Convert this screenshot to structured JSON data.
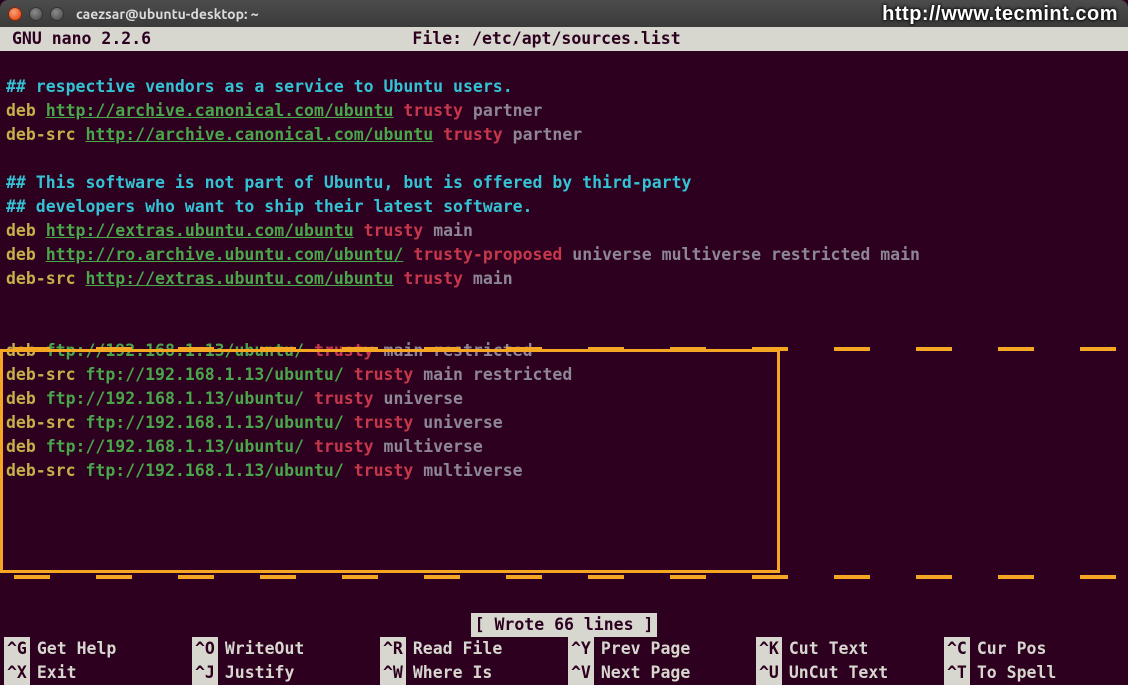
{
  "titlebar": {
    "title": "caezsar@ubuntu-desktop: ~"
  },
  "watermark": "http://www.tecmint.com",
  "nano": {
    "app": "GNU nano 2.2.6",
    "file_label": "File: /etc/apt/sources.list",
    "status": "[ Wrote 66 lines ]"
  },
  "lines": [
    {
      "t": "comment",
      "text": "## respective vendors as a service to Ubuntu users."
    },
    {
      "t": "deb",
      "kw": "deb",
      "url": "http://archive.canonical.com/ubuntu",
      "suite": "trusty",
      "comp": "partner"
    },
    {
      "t": "deb",
      "kw": "deb-src",
      "url": "http://archive.canonical.com/ubuntu",
      "suite": "trusty",
      "comp": "partner"
    },
    {
      "t": "empty"
    },
    {
      "t": "comment",
      "text": "## This software is not part of Ubuntu, but is offered by third-party"
    },
    {
      "t": "comment",
      "text": "## developers who want to ship their latest software."
    },
    {
      "t": "deb",
      "kw": "deb",
      "url": "http://extras.ubuntu.com/ubuntu",
      "suite": "trusty",
      "comp": "main"
    },
    {
      "t": "deb",
      "kw": "deb",
      "url": "http://ro.archive.ubuntu.com/ubuntu/",
      "suite": "trusty-proposed",
      "comp": "universe multiverse restricted main"
    },
    {
      "t": "deb",
      "kw": "deb-src",
      "url": "http://extras.ubuntu.com/ubuntu",
      "suite": "trusty",
      "comp": "main"
    },
    {
      "t": "empty"
    },
    {
      "t": "empty"
    },
    {
      "t": "deb",
      "kw": "deb",
      "url": "ftp://192.168.1.13/ubuntu/",
      "suite": "trusty",
      "comp": "main restricted"
    },
    {
      "t": "deb",
      "kw": "deb-src",
      "url": "ftp://192.168.1.13/ubuntu/",
      "suite": "trusty",
      "comp": "main restricted"
    },
    {
      "t": "deb",
      "kw": "deb",
      "url": "ftp://192.168.1.13/ubuntu/",
      "suite": "trusty",
      "comp": "universe"
    },
    {
      "t": "deb",
      "kw": "deb-src",
      "url": "ftp://192.168.1.13/ubuntu/",
      "suite": "trusty",
      "comp": "universe"
    },
    {
      "t": "deb",
      "kw": "deb",
      "url": "ftp://192.168.1.13/ubuntu/",
      "suite": "trusty",
      "comp": "multiverse"
    },
    {
      "t": "deb",
      "kw": "deb-src",
      "url": "ftp://192.168.1.13/ubuntu/",
      "suite": "trusty",
      "comp": "multiverse"
    }
  ],
  "shortcuts": {
    "row1": [
      {
        "key": "^G",
        "label": "Get Help"
      },
      {
        "key": "^O",
        "label": "WriteOut"
      },
      {
        "key": "^R",
        "label": "Read File"
      },
      {
        "key": "^Y",
        "label": "Prev Page"
      },
      {
        "key": "^K",
        "label": "Cut Text"
      },
      {
        "key": "^C",
        "label": "Cur Pos"
      }
    ],
    "row2": [
      {
        "key": "^X",
        "label": "Exit"
      },
      {
        "key": "^J",
        "label": "Justify"
      },
      {
        "key": "^W",
        "label": "Where Is"
      },
      {
        "key": "^V",
        "label": "Next Page"
      },
      {
        "key": "^U",
        "label": "UnCut Text"
      },
      {
        "key": "^T",
        "label": "To Spell"
      }
    ]
  }
}
